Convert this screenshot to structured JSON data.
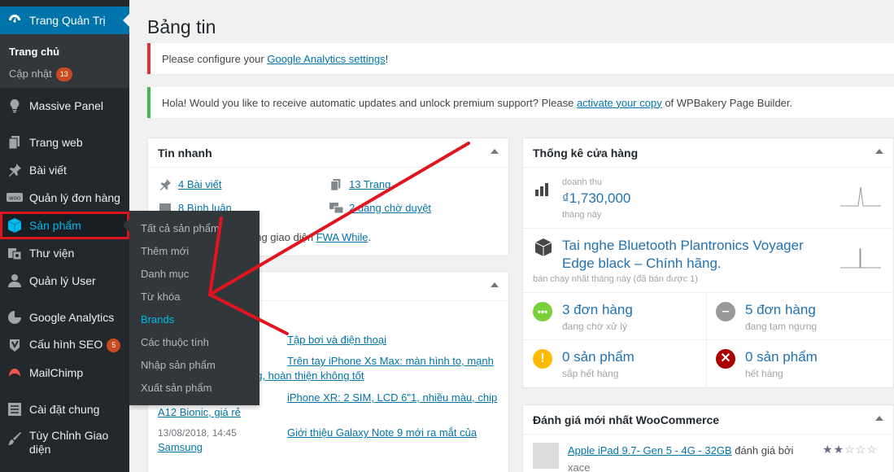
{
  "sidebar": {
    "admin": "Trang Quản Trị",
    "home": "Trang chủ",
    "updates": "Cập nhật",
    "updates_count": "13",
    "items": [
      {
        "label": "Massive Panel",
        "icon": "lightbulb-icon"
      },
      {
        "label": "Trang web",
        "icon": "pages-icon"
      },
      {
        "label": "Bài viết",
        "icon": "pin-icon"
      },
      {
        "label": "Quản lý đơn hàng",
        "icon": "woo-icon"
      },
      {
        "label": "Sản phẩm",
        "icon": "cube-icon"
      },
      {
        "label": "Thư viện",
        "icon": "media-icon"
      },
      {
        "label": "Quản lý User",
        "icon": "user-icon"
      },
      {
        "label": "Google Analytics",
        "icon": "analytics-icon"
      },
      {
        "label": "Cấu hình SEO",
        "icon": "seo-icon",
        "badge": "5"
      },
      {
        "label": "MailChimp",
        "icon": "mailchimp-icon"
      },
      {
        "label": "Cài đặt chung",
        "icon": "settings-icon"
      },
      {
        "label": "Tùy Chỉnh Giao",
        "label2": "diện",
        "icon": "brush-icon"
      }
    ]
  },
  "flyout": [
    "Tất cả sản phẩm",
    "Thêm mới",
    "Danh mục",
    "Từ khóa",
    "Brands",
    "Các thuộc tính",
    "Nhập sản phẩm",
    "Xuất sản phẩm"
  ],
  "page": {
    "title": "Bảng tin"
  },
  "notices": {
    "ga_pre": "Please configure your ",
    "ga_link": "Google Analytics settings",
    "ga_post": "!",
    "wpb_pre": "Hola! Would you like to receive automatic updates and unlock premium support? Please ",
    "wpb_link": "activate your copy",
    "wpb_post": " of WPBakery Page Builder."
  },
  "glance": {
    "title": "Tin nhanh",
    "posts": "4 Bài viết",
    "pages": "13 Trang",
    "comments": "8 Bình luận",
    "pending": "2 đang chờ duyệt",
    "theme_text": "ang giao diện ",
    "theme_link": "FWA While",
    "theme_post": "."
  },
  "activity": {
    "rows": [
      {
        "date": "",
        "link": "Tập bơi và điện thoại"
      },
      {
        "date": "",
        "link": "Trên tay iPhone Xs Max: màn hình to, mạnh"
      },
      {
        "date": "",
        "link": "ng, hoàn thiện không tốt"
      },
      {
        "date": "",
        "link": "iPhone XR: 2 SIM, LCD 6\"1, nhiều màu, chip"
      },
      {
        "date": "",
        "link": "A12 Bionic, giá rẻ"
      },
      {
        "date": "13/08/2018, 14:45",
        "link": "Giới thiệu Galaxy Note 9 mới ra mắt của"
      },
      {
        "date": "",
        "link": "Samsung"
      }
    ]
  },
  "store": {
    "title": "Thống kê cửa hàng",
    "revenue_label": "doanh thu",
    "revenue": "₫1,730,000",
    "revenue_period": "tháng này",
    "top_product_1": "Tai nghe Bluetooth Plantronics Voyager",
    "top_product_2": "Edge black – Chính hãng.",
    "top_product_sub": "bán chạy nhất tháng này (đã bán được 1)",
    "processing": "3 đơn hàng",
    "processing_sub": "đang chờ xử lý",
    "onhold": "5 đơn hàng",
    "onhold_sub": "đang tạm ngưng",
    "lowstock": "0 sản phẩm",
    "lowstock_sub": "sắp hết hàng",
    "outstock": "0 sản phẩm",
    "outstock_sub": "hết hàng"
  },
  "reviews": {
    "title": "Đánh giá mới nhất WooCommerce",
    "product": "Apple iPad 9.7- Gen 5 - 4G - 32GB",
    "by": " đánh giá bởi",
    "author": "xace",
    "stars": 2,
    "stars_max": 5
  },
  "colors": {
    "accent": "#0073aa",
    "sidebar": "#23282d",
    "highlight": "#e0151e",
    "success": "#46b450"
  }
}
